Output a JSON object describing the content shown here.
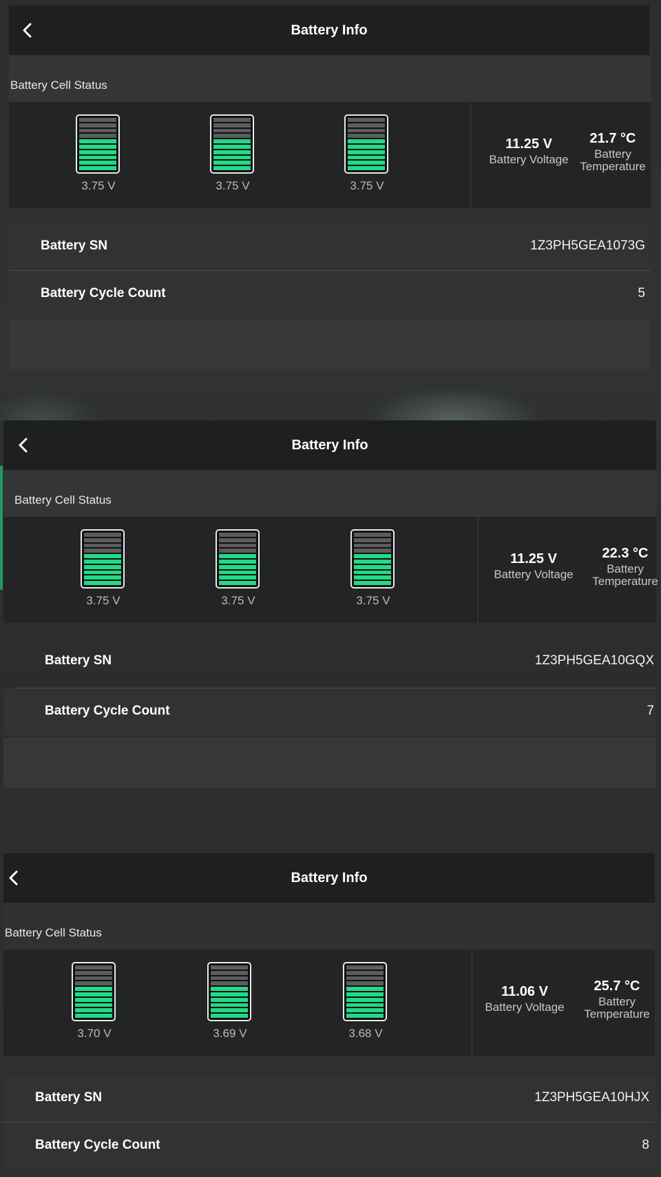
{
  "screens": [
    {
      "title": "Battery Info",
      "section_label": "Battery Cell Status",
      "cells": [
        {
          "voltage": "3.75 V",
          "level_segments": 6,
          "total_segments": 10
        },
        {
          "voltage": "3.75 V",
          "level_segments": 6,
          "total_segments": 10
        },
        {
          "voltage": "3.75 V",
          "level_segments": 6,
          "total_segments": 10
        }
      ],
      "battery_voltage": "11.25 V",
      "battery_voltage_label": "Battery Voltage",
      "battery_temperature": "21.7 °C",
      "battery_temperature_label_1": "Battery",
      "battery_temperature_label_2": "Temperature",
      "sn_label": "Battery SN",
      "sn_value": "1Z3PH5GEA1073G",
      "cycle_label": "Battery Cycle Count",
      "cycle_value": "5"
    },
    {
      "title": "Battery Info",
      "section_label": "Battery Cell Status",
      "cells": [
        {
          "voltage": "3.75 V",
          "level_segments": 6,
          "total_segments": 10
        },
        {
          "voltage": "3.75 V",
          "level_segments": 6,
          "total_segments": 10
        },
        {
          "voltage": "3.75 V",
          "level_segments": 6,
          "total_segments": 10
        }
      ],
      "battery_voltage": "11.25 V",
      "battery_voltage_label": "Battery Voltage",
      "battery_temperature": "22.3 °C",
      "battery_temperature_label_1": "Battery",
      "battery_temperature_label_2": "Temperature",
      "sn_label": "Battery SN",
      "sn_value": "1Z3PH5GEA10GQX",
      "cycle_label": "Battery Cycle Count",
      "cycle_value": "7"
    },
    {
      "title": "Battery Info",
      "section_label": "Battery Cell Status",
      "cells": [
        {
          "voltage": "3.70 V",
          "level_segments": 6,
          "total_segments": 10
        },
        {
          "voltage": "3.69 V",
          "level_segments": 6,
          "total_segments": 10
        },
        {
          "voltage": "3.68 V",
          "level_segments": 6,
          "total_segments": 10
        }
      ],
      "battery_voltage": "11.06 V",
      "battery_voltage_label": "Battery Voltage",
      "battery_temperature": "25.7 °C",
      "battery_temperature_label_1": "Battery",
      "battery_temperature_label_2": "Temperature",
      "sn_label": "Battery SN",
      "sn_value": "1Z3PH5GEA10HJX",
      "cycle_label": "Battery Cycle Count",
      "cycle_value": "8"
    }
  ],
  "colors": {
    "cell_fill": "#22d986",
    "cell_empty": "#5b5d5f",
    "header_bg": "#1d1f21"
  },
  "icons": {
    "back": "chevron-left-icon"
  }
}
